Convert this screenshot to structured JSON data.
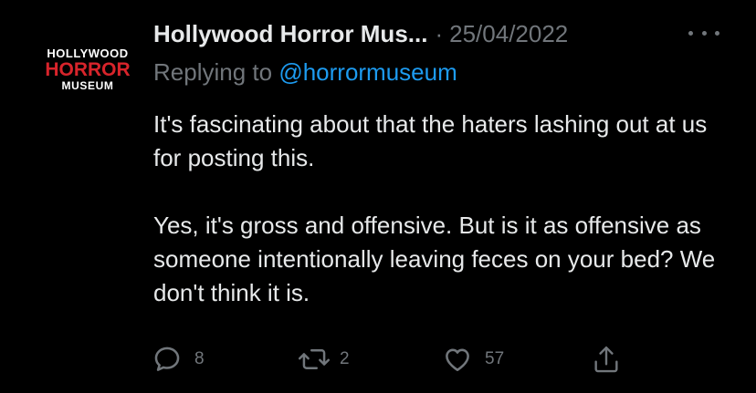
{
  "author": {
    "display_name": "Hollywood Horror Mus...",
    "separator": "·",
    "date": "25/04/2022",
    "avatar": {
      "line1": "HOLLYWOOD",
      "line2": "HORROR",
      "line3": "MUSEUM",
      "accent_color": "#d8242b"
    }
  },
  "reply": {
    "prefix": "Replying to",
    "handle": "@horrormuseum"
  },
  "tweet": {
    "paragraph1": "It's fascinating about that the haters lashing out at us for posting this.",
    "paragraph2": "Yes, it's gross and offensive. But is it as offensive as someone intentionally leaving feces on your bed? We don't think it is."
  },
  "actions": {
    "replies": "8",
    "retweets": "2",
    "likes": "57",
    "icons": [
      "reply-icon",
      "retweet-icon",
      "like-icon",
      "share-icon"
    ]
  },
  "colors": {
    "background": "#000000",
    "text": "#e7e9ea",
    "muted": "#71767b",
    "link": "#1d9bf0"
  }
}
